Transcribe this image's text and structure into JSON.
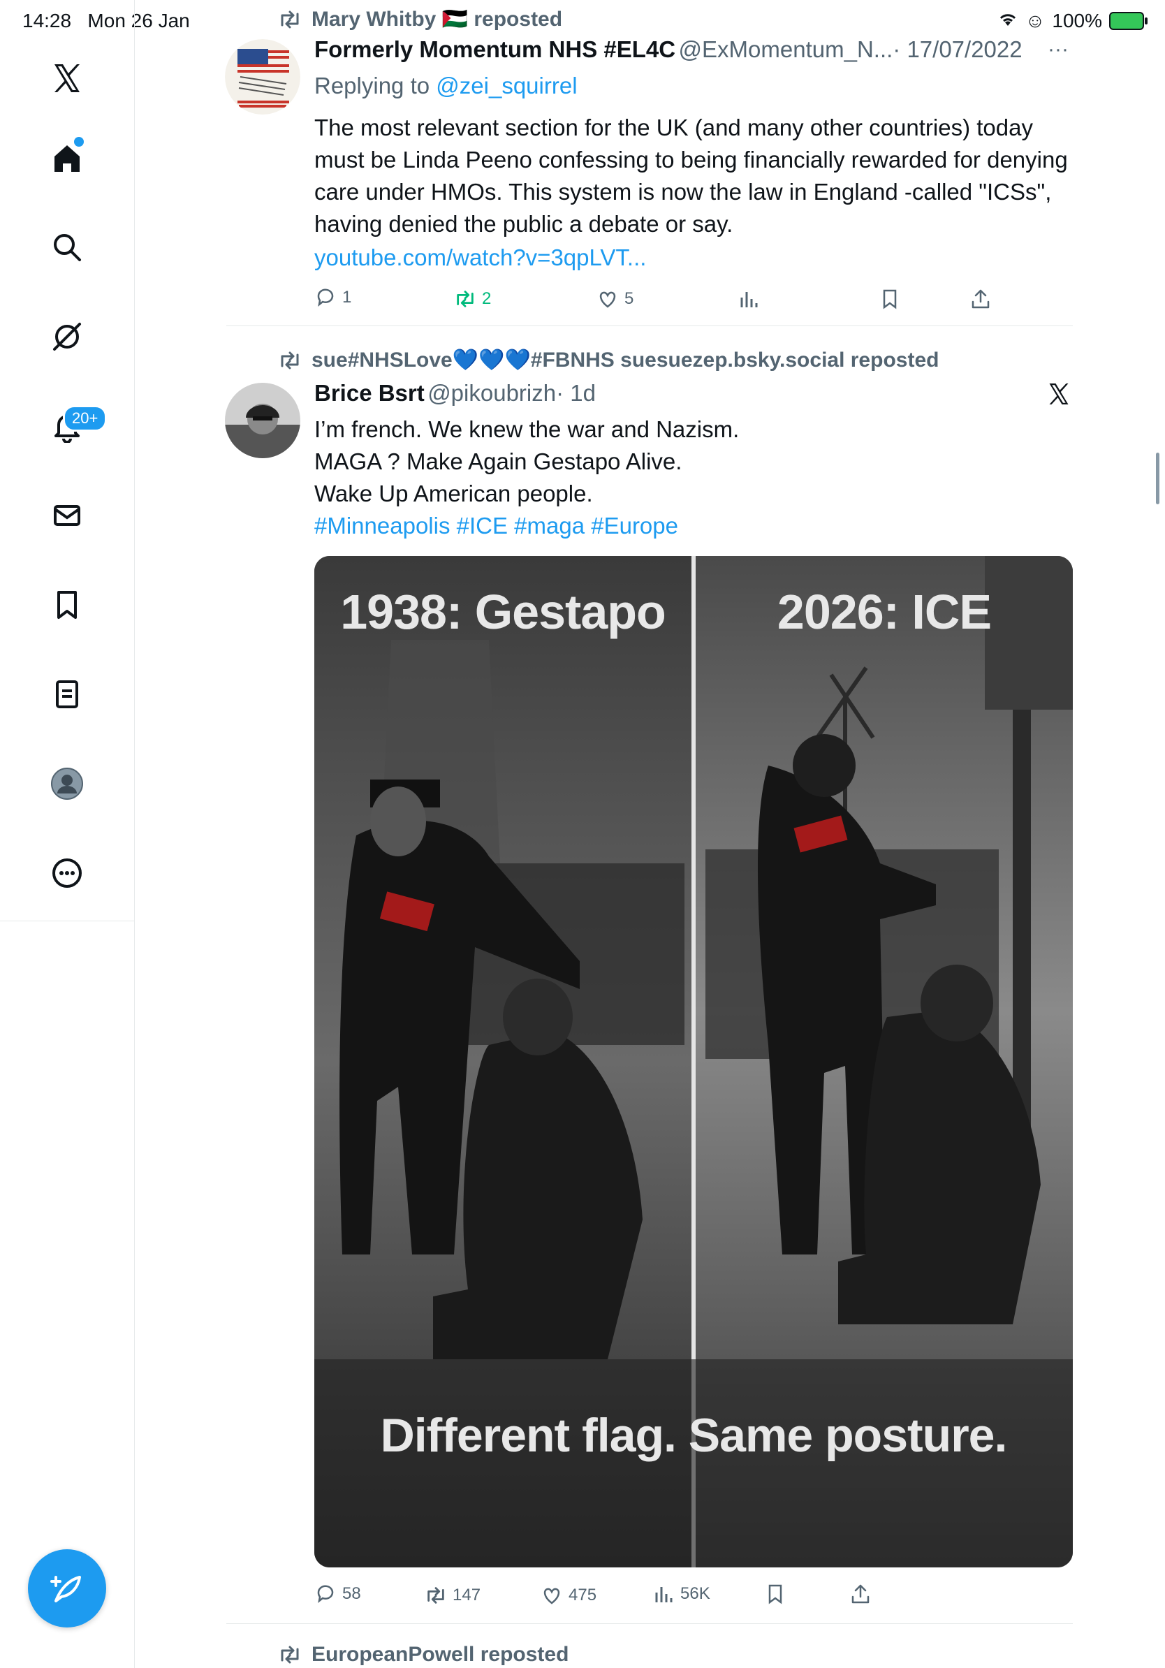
{
  "status_bar": {
    "time": "14:28",
    "date": "Mon 26 Jan",
    "battery": "100%"
  },
  "sidebar": {
    "notifications_badge": "20+"
  },
  "tweets": [
    {
      "reposted_by": "Mary Whitby 🇵🇸 reposted",
      "name": "Formerly Momentum NHS #EL4C",
      "handle": "@ExMomentum_N...",
      "date": "· 17/07/2022",
      "replying_label": "Replying to",
      "replying_to": "@zei_squirrel",
      "text": "The most relevant section for the UK (and many other countries) today must be Linda Peeno confessing to being financially rewarded for denying care under HMOs. This system is now the law in England -called \"ICSs\", having denied the public a debate or say.",
      "link": "youtube.com/watch?v=3qpLVT...",
      "replies": "1",
      "reposts": "2",
      "likes": "5"
    },
    {
      "reposted_by": "sue#NHSLove💙💙💙#FBNHS suesuezep.bsky.social reposted",
      "name": "Brice Bsrt",
      "handle": "@pikoubrizh",
      "date": "· 1d",
      "lines": [
        "I’m french. We knew the war and Nazism.",
        "MAGA ? Make Again Gestapo Alive.",
        "Wake Up American people."
      ],
      "hashtags": "#Minneapolis #ICE #maga #Europe",
      "image": {
        "left_caption": "1938: Gestapo",
        "right_caption": "2026: ICE",
        "bottom_caption": "Different flag. Same posture."
      },
      "replies": "58",
      "reposts": "147",
      "likes": "475",
      "views": "56K"
    },
    {
      "reposted_by": "EuropeanPowell reposted"
    }
  ]
}
